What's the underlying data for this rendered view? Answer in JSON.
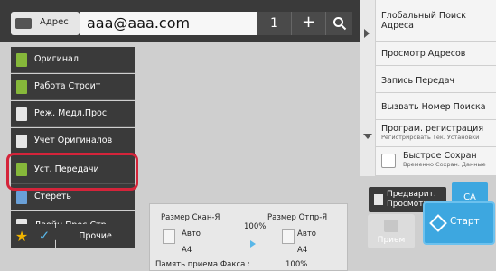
{
  "topbar": {
    "address_label": "Адрес",
    "address_value": "aaa@aaa.com",
    "count": "1",
    "plus": "+"
  },
  "right_panel": {
    "global_search": "Глобальный Поиск Адреса",
    "view_addresses": "Просмотр Адресов",
    "send_record": "Запись Передач",
    "recall_search_number": "Вызвать Номер Поиска",
    "program_registration": "Програм. регистрация",
    "program_registration_sub": "Регистрировать Тек. Установки",
    "quick_save": "Быстрое Сохран",
    "quick_save_sub": "Временно Сохран. Данные"
  },
  "left_menu": {
    "items": [
      {
        "label": "Оригинал"
      },
      {
        "label": "Работа Строит"
      },
      {
        "label": "Реж. Медл.Прос"
      },
      {
        "label": "Учет Оригиналов"
      },
      {
        "label": "Уст. Передачи"
      },
      {
        "label": "Стереть"
      },
      {
        "label": "Двойн.Прос.Стр"
      }
    ]
  },
  "bottom_left": {
    "other_label": "Прочие",
    "star_icon": "star-icon",
    "check_icon": "check-icon"
  },
  "info": {
    "scan_size_label": "Размер Скан-Я",
    "send_size_label": "Размер Отпр-Я",
    "ratio": "100%",
    "scan_auto": "Авто",
    "send_auto": "Авто",
    "scan_paper": "A4",
    "send_paper": "A4",
    "fax_memory_label": "Память приема Факса :",
    "fax_memory_value": "100%"
  },
  "actions": {
    "preview": "Предварит. Просмотр",
    "ca": "CA",
    "receive": "Прием",
    "start": "Старт"
  },
  "colors": {
    "accent": "#3da7e0",
    "highlight": "#d4243a",
    "dark": "#3a3a3a"
  }
}
